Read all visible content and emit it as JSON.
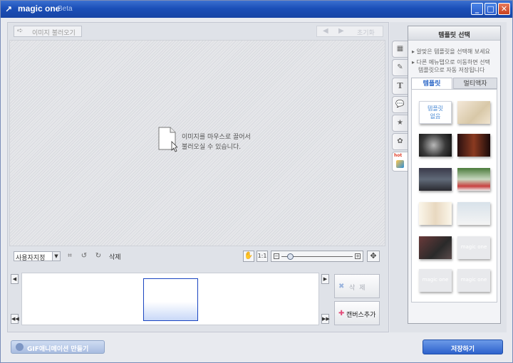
{
  "window": {
    "title": "magic one",
    "subtitle": "Beta",
    "minimize_glyph": "_",
    "maximize_glyph": "□",
    "close_glyph": "✕"
  },
  "toolbar": {
    "load_label": "이미지 불러오기",
    "prev_glyph": "◀",
    "next_glyph": "▶",
    "reset_label": "초기화"
  },
  "canvas": {
    "hint_line1": "이미지를 마우스로 끌어서",
    "hint_line2": "불러오실 수 있습니다."
  },
  "bottom_toolbar": {
    "size_value": "사용자지정",
    "delete_label": "삭제",
    "one_to_one": "1:1",
    "zoom_level": 0.12
  },
  "strip": {
    "delete_label": "삭제",
    "add_canvas_label": "캔버스추가"
  },
  "panel": {
    "title": "템플릿 선택",
    "desc1": "▸ 알맞은 템플릿을 선택해 보세요",
    "desc2": "▸ 다른 메뉴탭으로 이동하면 선택",
    "desc3": "템플릿으로 자동 저장됩니다",
    "tab_templates": "템플릿",
    "tab_multiframe": "멀티액자",
    "hot_label": "hot",
    "no_template_line1": "템플릿",
    "no_template_line2": "없음",
    "watermark": "magic one"
  },
  "footer": {
    "gif_label": "GIF애니메이션 만들기",
    "save_label": "저장하기"
  },
  "colors": {
    "title_bar": "#1b4fb8",
    "accent_blue": "#2d62cc",
    "frame_border": "#1a45c0",
    "add_icon": "#e24c7a"
  }
}
